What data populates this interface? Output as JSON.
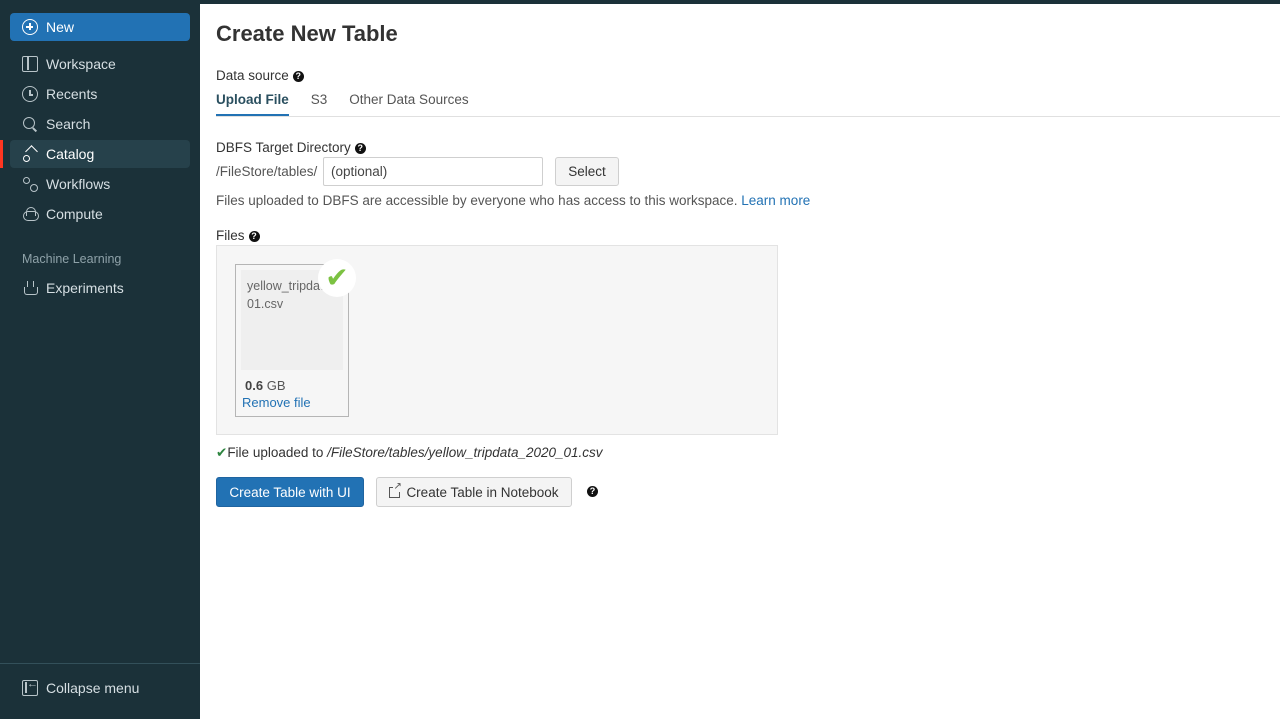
{
  "sidebar": {
    "new_label": "New",
    "items": [
      {
        "label": "Workspace"
      },
      {
        "label": "Recents"
      },
      {
        "label": "Search"
      },
      {
        "label": "Catalog"
      },
      {
        "label": "Workflows"
      },
      {
        "label": "Compute"
      }
    ],
    "section_label": "Machine Learning",
    "ml_items": [
      {
        "label": "Experiments"
      }
    ],
    "collapse_label": "Collapse menu",
    "active_item": "Catalog"
  },
  "page": {
    "title": "Create New Table",
    "data_source_label": "Data source",
    "tabs": [
      {
        "label": "Upload File",
        "active": true
      },
      {
        "label": "S3",
        "active": false
      },
      {
        "label": "Other Data Sources",
        "active": false
      }
    ],
    "dbfs": {
      "label": "DBFS Target Directory",
      "prefix": "/FileStore/tables/",
      "placeholder": "(optional)",
      "select_label": "Select",
      "info_text": "Files uploaded to DBFS are accessible by everyone who has access to this workspace.",
      "learn_more": "Learn more"
    },
    "files": {
      "label": "Files",
      "file_name": "yellow_tripdata_2020_01.csv",
      "file_name_visible": "yellow_tripda… 01.csv",
      "size_value": "0.6",
      "size_unit": "GB",
      "remove_label": "Remove file"
    },
    "upload_message": {
      "prefix": "File uploaded to ",
      "path": "/FileStore/tables/yellow_tripdata_2020_01.csv"
    },
    "actions": {
      "create_ui": "Create Table with UI",
      "create_notebook": "Create Table in Notebook"
    }
  },
  "colors": {
    "sidebar_bg": "#1b3139",
    "accent": "#2272b4",
    "active_marker": "#ff3621",
    "success": "#7cc242"
  }
}
